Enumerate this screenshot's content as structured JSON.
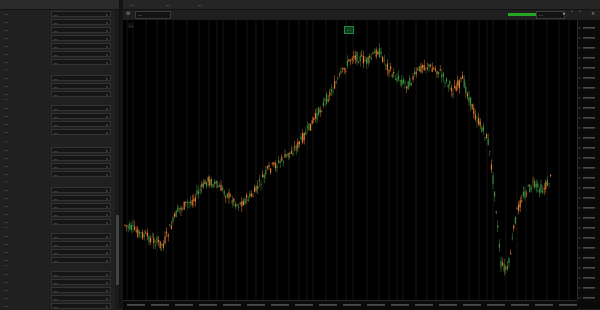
{
  "left_panel": {
    "header": "",
    "rows": [
      {
        "label": "...",
        "value": "..."
      },
      {
        "label": "...",
        "value": "..."
      },
      {
        "label": "...",
        "value": "..."
      },
      {
        "label": "...",
        "value": "..."
      },
      {
        "label": "...",
        "value": "..."
      },
      {
        "label": "...",
        "value": "..."
      },
      {
        "label": "...",
        "value": "..."
      },
      {
        "label": "...",
        "value": "..."
      },
      {
        "label": "...",
        "value": "..."
      },
      {
        "label": "...",
        "value": "..."
      },
      {
        "label": "...",
        "value": "..."
      },
      {
        "label": "...",
        "value": "..."
      },
      {
        "label": "...",
        "value": "..."
      },
      {
        "label": "...",
        "value": "..."
      },
      {
        "label": "...",
        "value": "..."
      },
      {
        "label": "...",
        "value": "..."
      },
      {
        "label": "...",
        "value": "..."
      },
      {
        "label": "...",
        "value": "..."
      },
      {
        "label": "...",
        "value": "..."
      },
      {
        "label": "...",
        "value": "..."
      },
      {
        "label": "...",
        "value": "..."
      },
      {
        "label": "...",
        "value": "..."
      },
      {
        "label": "...",
        "value": "..."
      },
      {
        "label": "...",
        "value": "..."
      },
      {
        "label": "...",
        "value": "..."
      },
      {
        "label": "...",
        "value": "..."
      },
      {
        "label": "...",
        "value": "..."
      },
      {
        "label": "...",
        "value": "..."
      },
      {
        "label": "...",
        "value": "..."
      },
      {
        "label": "...",
        "value": "..."
      },
      {
        "label": "...",
        "value": "..."
      },
      {
        "label": "...",
        "value": "..."
      },
      {
        "label": "...",
        "value": "..."
      },
      {
        "label": "...",
        "value": "..."
      },
      {
        "label": "...",
        "value": "..."
      },
      {
        "label": "...",
        "value": "..."
      }
    ],
    "sections": [
      "...",
      "...",
      "...",
      "...",
      "...",
      "..."
    ]
  },
  "tabs": [
    {
      "label": "..."
    },
    {
      "label": "..."
    },
    {
      "label": "..."
    }
  ],
  "toolbar": {
    "start_date": "...",
    "end_date": "...",
    "progress": 0.93
  },
  "chart": {
    "price_label": "...",
    "pill": "..."
  },
  "colors": {
    "up": "#3f8f3f",
    "down": "#e07a2e",
    "vline": "#5a5a5a"
  }
}
